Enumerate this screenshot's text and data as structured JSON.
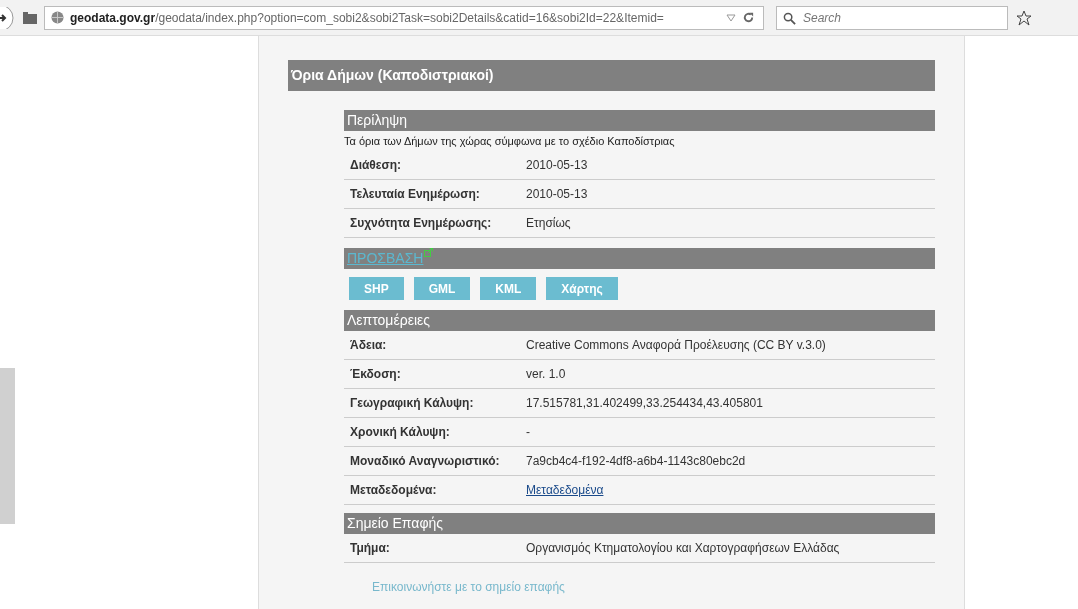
{
  "browser": {
    "url_host": "geodata.gov.gr",
    "url_path": "/geodata/index.php?option=com_sobi2&sobi2Task=sobi2Details&catid=16&sobi2Id=22&Itemid=",
    "search_placeholder": "Search"
  },
  "page": {
    "title": "Όρια Δήμων (Καποδιστριακοί)",
    "summary": {
      "heading": "Περίληψη",
      "description": "Τα όρια των Δήμων της χώρας σύμφωνα με το σχέδιο Καποδίστριας",
      "rows": [
        {
          "label": "Διάθεση:",
          "value": "2010-05-13"
        },
        {
          "label": "Τελευταία Ενημέρωση:",
          "value": "2010-05-13"
        },
        {
          "label": "Συχνότητα Ενημέρωσης:",
          "value": "Ετησίως"
        }
      ]
    },
    "access": {
      "heading": "ΠΡΟΣΒΑΣΗ",
      "buttons": [
        "SHP",
        "GML",
        "KML",
        "Χάρτης"
      ]
    },
    "details": {
      "heading": "Λεπτομέρειες",
      "rows": [
        {
          "label": "Άδεια:",
          "value": "Creative Commons Αναφορά Προέλευσης (CC BY v.3.0)",
          "kind": "text"
        },
        {
          "label": "Έκδοση:",
          "value": "ver. 1.0",
          "kind": "text"
        },
        {
          "label": "Γεωγραφική Κάλυψη:",
          "value": "17.515781,31.402499,33.254434,43.405801",
          "kind": "text"
        },
        {
          "label": "Χρονική Κάλυψη:",
          "value": "-",
          "kind": "text"
        },
        {
          "label": "Μοναδικό Αναγνωριστικό:",
          "value": "7a9cb4c4-f192-4df8-a6b4-1143c80ebc2d",
          "kind": "text"
        },
        {
          "label": "Μεταδεδομένα:",
          "value": "Μεταδεδομένα",
          "kind": "link"
        }
      ]
    },
    "contact": {
      "heading": "Σημείο Επαφής",
      "rows": [
        {
          "label": "Τμήμα:",
          "value": "Οργανισμός Κτηματολογίου και Χαρτογραφήσεων Ελλάδας"
        }
      ],
      "link": "Επικοινωνήστε με το σημείο επαφής"
    }
  }
}
